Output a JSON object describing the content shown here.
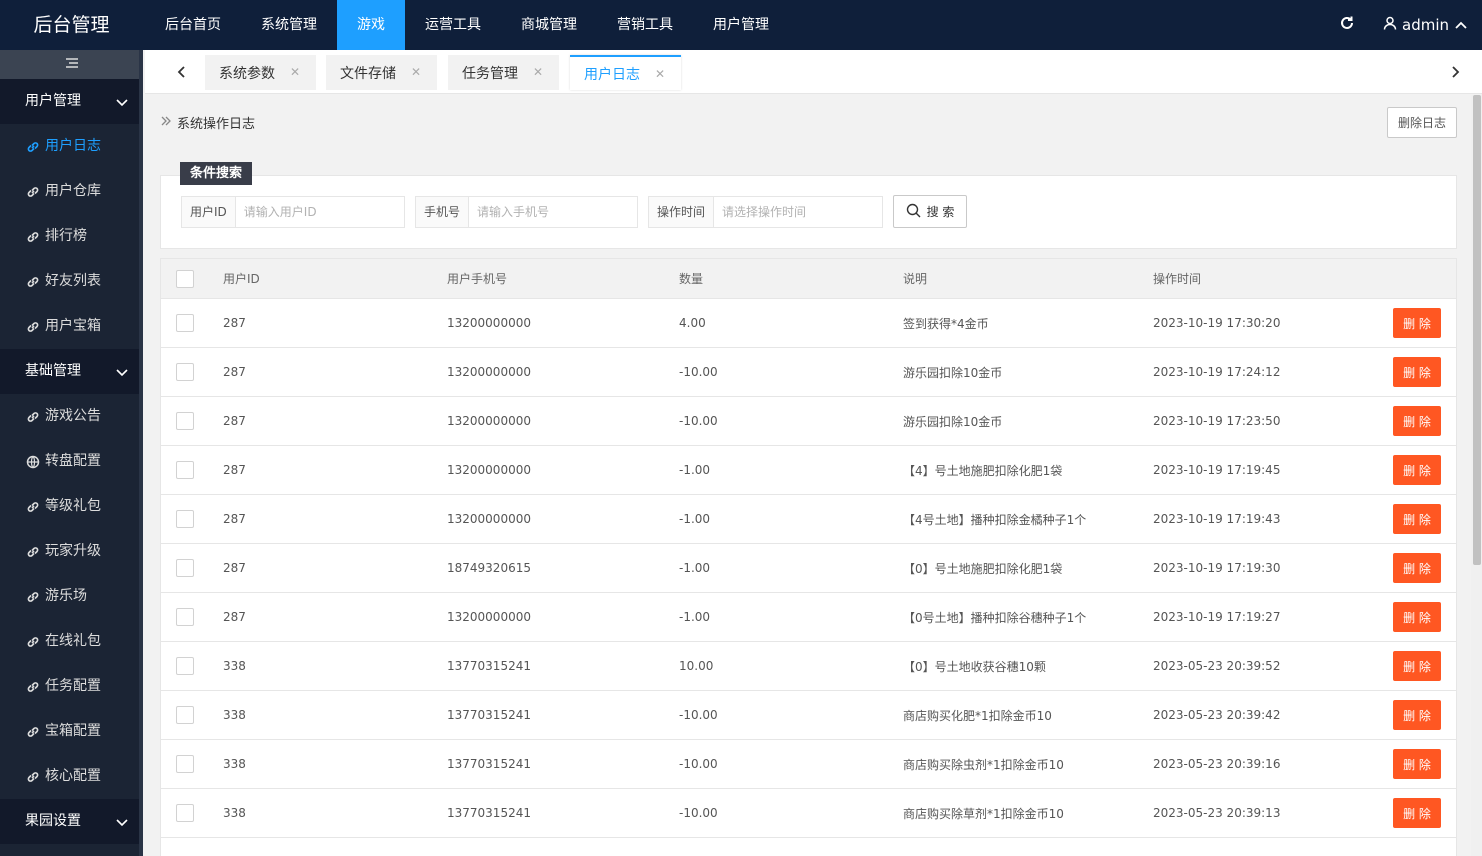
{
  "app": {
    "logo": "后台管理",
    "user": "admin"
  },
  "topnav": [
    {
      "label": "后台首页",
      "active": false
    },
    {
      "label": "系统管理",
      "active": false
    },
    {
      "label": "游戏",
      "active": true
    },
    {
      "label": "运营工具",
      "active": false
    },
    {
      "label": "商城管理",
      "active": false
    },
    {
      "label": "营销工具",
      "active": false
    },
    {
      "label": "用户管理",
      "active": false
    }
  ],
  "sidebar": {
    "groups": [
      {
        "label": "用户管理",
        "items": [
          {
            "label": "用户日志",
            "icon": "link-icon",
            "active": true
          },
          {
            "label": "用户仓库",
            "icon": "link-icon"
          },
          {
            "label": "排行榜",
            "icon": "link-icon"
          },
          {
            "label": "好友列表",
            "icon": "link-icon"
          },
          {
            "label": "用户宝箱",
            "icon": "link-icon"
          }
        ]
      },
      {
        "label": "基础管理",
        "items": [
          {
            "label": "游戏公告",
            "icon": "link-icon"
          },
          {
            "label": "转盘配置",
            "icon": "globe-icon"
          },
          {
            "label": "等级礼包",
            "icon": "link-icon"
          },
          {
            "label": "玩家升级",
            "icon": "link-icon"
          },
          {
            "label": "游乐场",
            "icon": "link-icon"
          },
          {
            "label": "在线礼包",
            "icon": "link-icon"
          },
          {
            "label": "任务配置",
            "icon": "link-icon"
          },
          {
            "label": "宝箱配置",
            "icon": "link-icon"
          },
          {
            "label": "核心配置",
            "icon": "link-icon"
          }
        ]
      },
      {
        "label": "果园设置",
        "items": []
      }
    ]
  },
  "tabs": [
    {
      "label": "系统参数",
      "active": false
    },
    {
      "label": "文件存储",
      "active": false
    },
    {
      "label": "任务管理",
      "active": false
    },
    {
      "label": "用户日志",
      "active": true
    }
  ],
  "page": {
    "title": "系统操作日志",
    "delete_log_label": "删除日志"
  },
  "search": {
    "legend": "条件搜索",
    "user_id_label": "用户ID",
    "user_id_placeholder": "请输入用户ID",
    "phone_label": "手机号",
    "phone_placeholder": "请输入手机号",
    "time_label": "操作时间",
    "time_placeholder": "请选择操作时间",
    "button_label": "搜 索"
  },
  "table": {
    "columns": [
      "用户ID",
      "用户手机号",
      "数量",
      "说明",
      "操作时间"
    ],
    "delete_label": "删 除",
    "rows": [
      {
        "id": "287",
        "phone": "13200000000",
        "qty": "4.00",
        "desc": "签到获得*4金币",
        "time": "2023-10-19 17:30:20"
      },
      {
        "id": "287",
        "phone": "13200000000",
        "qty": "-10.00",
        "desc": "游乐园扣除10金币",
        "time": "2023-10-19 17:24:12"
      },
      {
        "id": "287",
        "phone": "13200000000",
        "qty": "-10.00",
        "desc": "游乐园扣除10金币",
        "time": "2023-10-19 17:23:50"
      },
      {
        "id": "287",
        "phone": "13200000000",
        "qty": "-1.00",
        "desc": "【4】号土地施肥扣除化肥1袋",
        "time": "2023-10-19 17:19:45"
      },
      {
        "id": "287",
        "phone": "13200000000",
        "qty": "-1.00",
        "desc": "【4号土地】播种扣除金橘种子1个",
        "time": "2023-10-19 17:19:43"
      },
      {
        "id": "287",
        "phone": "18749320615",
        "qty": "-1.00",
        "desc": "【0】号土地施肥扣除化肥1袋",
        "time": "2023-10-19 17:19:30"
      },
      {
        "id": "287",
        "phone": "13200000000",
        "qty": "-1.00",
        "desc": "【0号土地】播种扣除谷穗种子1个",
        "time": "2023-10-19 17:19:27"
      },
      {
        "id": "338",
        "phone": "13770315241",
        "qty": "10.00",
        "desc": "【0】号土地收获谷穗10颗",
        "time": "2023-05-23 20:39:52"
      },
      {
        "id": "338",
        "phone": "13770315241",
        "qty": "-10.00",
        "desc": "商店购买化肥*1扣除金币10",
        "time": "2023-05-23 20:39:42"
      },
      {
        "id": "338",
        "phone": "13770315241",
        "qty": "-10.00",
        "desc": "商店购买除虫剂*1扣除金币10",
        "time": "2023-05-23 20:39:16"
      },
      {
        "id": "338",
        "phone": "13770315241",
        "qty": "-10.00",
        "desc": "商店购买除草剂*1扣除金币10",
        "time": "2023-05-23 20:39:13"
      }
    ]
  },
  "colors": {
    "topbar": "#0f1f3a",
    "accent": "#1e9fff",
    "danger": "#ff5722",
    "sidebar": "#1b2434"
  }
}
